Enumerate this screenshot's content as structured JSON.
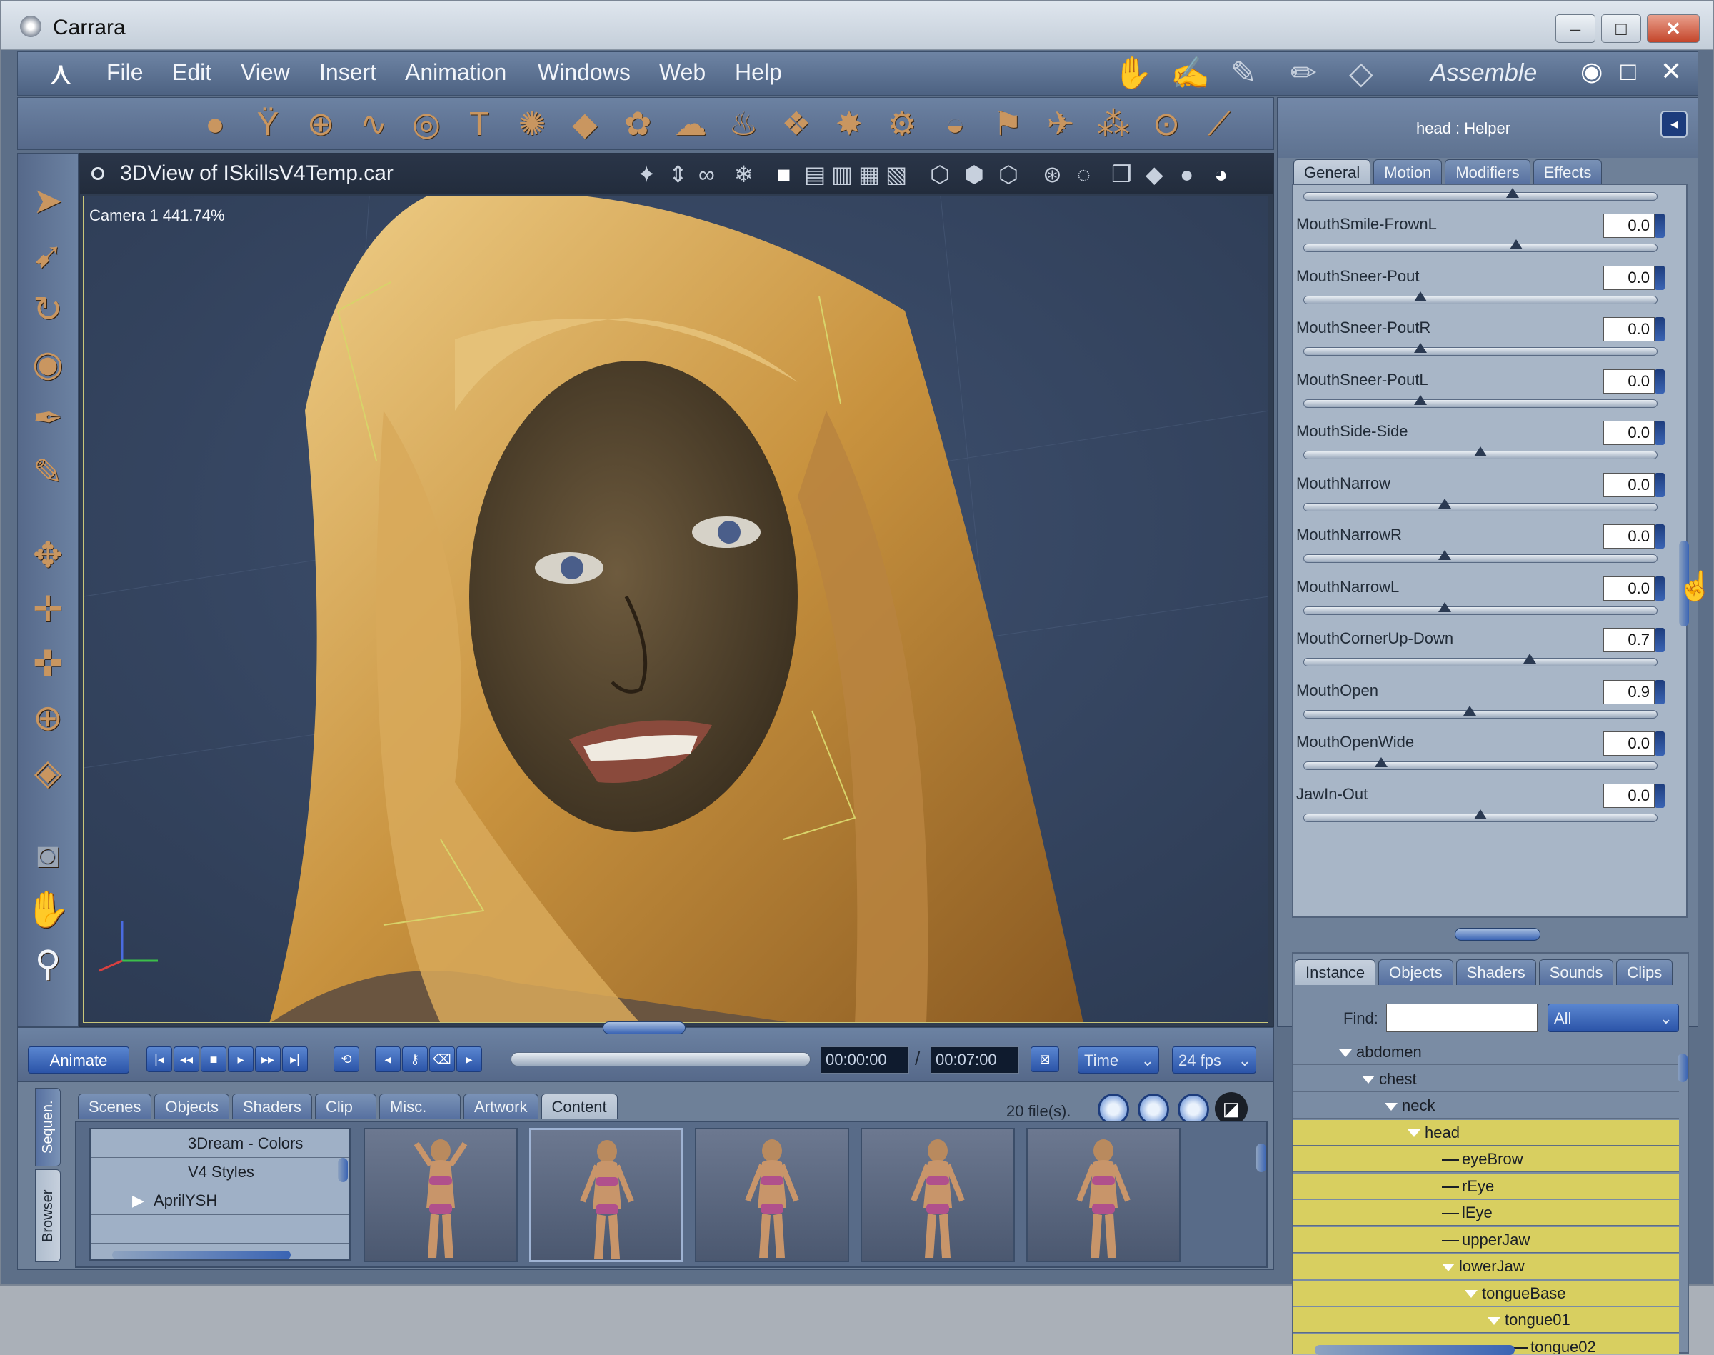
{
  "window": {
    "title": "Carrara"
  },
  "menubar": {
    "items": [
      "File",
      "Edit",
      "View",
      "Insert",
      "Animation",
      "Windows",
      "Web",
      "Help"
    ],
    "room": "Assemble"
  },
  "viewport": {
    "title": "3DView of ISkillsV4Temp.car",
    "camera_label": "Camera 1 441.74%"
  },
  "properties": {
    "header": "head : Helper",
    "tabs": [
      "General",
      "Motion",
      "Modifiers",
      "Effects"
    ],
    "rows": [
      {
        "name": "MouthSmile-FrownL",
        "value": "0.0",
        "slider": 0.6
      },
      {
        "name": "MouthSneer-Pout",
        "value": "0.0",
        "slider": 0.33
      },
      {
        "name": "MouthSneer-PoutR",
        "value": "0.0",
        "slider": 0.33
      },
      {
        "name": "MouthSneer-PoutL",
        "value": "0.0",
        "slider": 0.33
      },
      {
        "name": "MouthSide-Side",
        "value": "0.0",
        "slider": 0.5
      },
      {
        "name": "MouthNarrow",
        "value": "0.0",
        "slider": 0.4
      },
      {
        "name": "MouthNarrowR",
        "value": "0.0",
        "slider": 0.4
      },
      {
        "name": "MouthNarrowL",
        "value": "0.0",
        "slider": 0.4
      },
      {
        "name": "MouthCornerUp-Down",
        "value": "0.7",
        "slider": 0.64
      },
      {
        "name": "MouthOpen",
        "value": "0.9",
        "slider": 0.47
      },
      {
        "name": "MouthOpenWide",
        "value": "0.0",
        "slider": 0.22
      },
      {
        "name": "JawIn-Out",
        "value": "0.0",
        "slider": 0.5
      }
    ]
  },
  "instances": {
    "tabs": [
      "Instance",
      "Objects",
      "Shaders",
      "Sounds",
      "Clips"
    ],
    "find_label": "Find:",
    "filter": "All",
    "tree": [
      {
        "label": "abdomen",
        "selected": false
      },
      {
        "label": "chest",
        "selected": false
      },
      {
        "label": "neck",
        "selected": false
      },
      {
        "label": "head",
        "selected": true
      },
      {
        "label": "eyeBrow",
        "selected": true
      },
      {
        "label": "rEye",
        "selected": true
      },
      {
        "label": "lEye",
        "selected": true
      },
      {
        "label": "upperJaw",
        "selected": true
      },
      {
        "label": "lowerJaw",
        "selected": true
      },
      {
        "label": "tongueBase",
        "selected": true
      },
      {
        "label": "tongue01",
        "selected": true
      },
      {
        "label": "tongue02",
        "selected": true
      }
    ]
  },
  "timebar": {
    "animate_label": "Animate",
    "current_time": "00:00:00",
    "separator": "/",
    "end_time": "00:07:00",
    "time_mode": "Time",
    "fps": "24 fps"
  },
  "browser": {
    "side_tabs": [
      "Sequen.",
      "Browser"
    ],
    "tabs": [
      "Scenes",
      "Objects",
      "Shaders",
      "Clip",
      "Misc.",
      "Artwork",
      "Content"
    ],
    "active_tab": "Content",
    "file_count": "20 file(s).",
    "folders": [
      "3Dream - Colors",
      "V4 Styles",
      "AprilYSH"
    ],
    "thumbnail_count": 5
  },
  "colors": {
    "accent": "#2b54a8",
    "selection": "#d8cf60",
    "viewport_bg": "#3a4a68",
    "chrome": "#5d6f88"
  }
}
